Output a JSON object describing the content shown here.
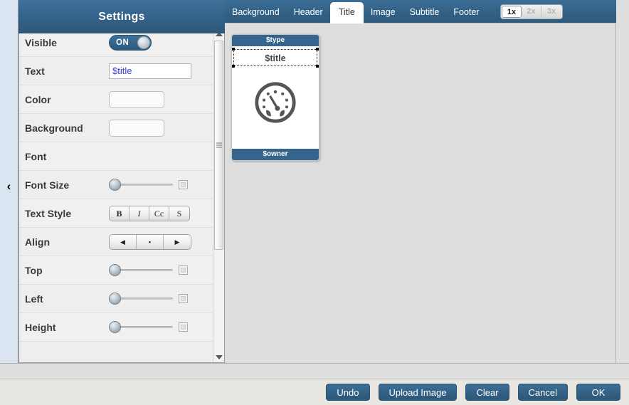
{
  "header": {
    "settings_title": "Settings"
  },
  "tabs": [
    {
      "label": "Background",
      "active": false
    },
    {
      "label": "Header",
      "active": false
    },
    {
      "label": "Title",
      "active": true
    },
    {
      "label": "Image",
      "active": false
    },
    {
      "label": "Subtitle",
      "active": false
    },
    {
      "label": "Footer",
      "active": false
    }
  ],
  "zoom_levels": [
    {
      "label": "1x",
      "active": true
    },
    {
      "label": "2x",
      "active": false
    },
    {
      "label": "3x",
      "active": false
    }
  ],
  "rail": {
    "collapse_icon": "‹"
  },
  "settings_rows": {
    "visible": {
      "label": "Visible",
      "toggle_value": "ON"
    },
    "text": {
      "label": "Text",
      "value": "$title",
      "placeholder": ""
    },
    "color": {
      "label": "Color",
      "swatch": "#fbfbfb"
    },
    "background": {
      "label": "Background",
      "swatch": "#fbfbfb"
    },
    "font": {
      "label": "Font"
    },
    "font_size": {
      "label": "Font Size"
    },
    "text_style": {
      "label": "Text Style",
      "buttons": [
        "B",
        "I",
        "Cc",
        "S"
      ]
    },
    "align": {
      "label": "Align",
      "buttons": [
        "◀",
        "▪",
        "▶"
      ]
    },
    "top": {
      "label": "Top"
    },
    "left": {
      "label": "Left"
    },
    "height": {
      "label": "Height"
    }
  },
  "preview_card": {
    "type_text": "$type",
    "title_text": "$title",
    "owner_text": "$owner",
    "image_icon": "gauge-icon"
  },
  "footer_buttons": [
    {
      "label": "Undo"
    },
    {
      "label": "Upload Image"
    },
    {
      "label": "Clear"
    },
    {
      "label": "Cancel"
    },
    {
      "label": "OK"
    }
  ],
  "colors": {
    "brand_blue": "#35658c",
    "panel_bg": "#eeeeee",
    "canvas_bg": "#dedede",
    "rail_bg": "#dbe5f1",
    "input_text": "#3a3ad0"
  }
}
